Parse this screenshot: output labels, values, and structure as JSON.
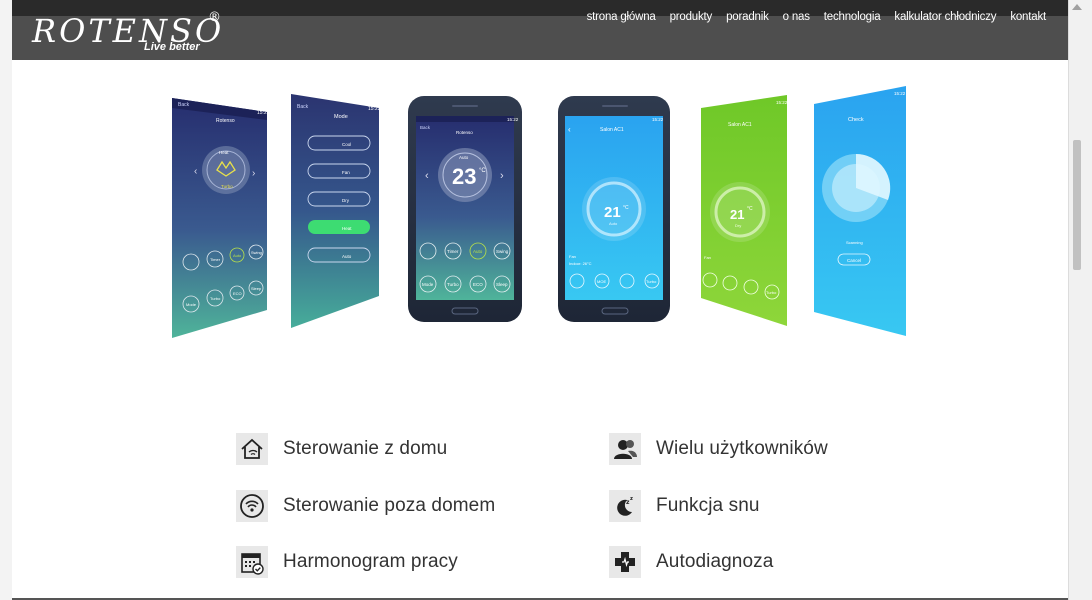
{
  "brand": {
    "name": "ROTENSO",
    "registered": "®",
    "tagline": "Live better"
  },
  "nav": {
    "items": [
      {
        "label": "strona główna"
      },
      {
        "label": "produkty"
      },
      {
        "label": "poradnik"
      },
      {
        "label": "o nas"
      },
      {
        "label": "technologia"
      },
      {
        "label": "kalkulator chłodniczy"
      },
      {
        "label": "kontakt"
      }
    ]
  },
  "phones": {
    "screen1": {
      "back": "Back",
      "title": "Rotenso",
      "mode": "Heat",
      "sub": "Turbo",
      "time": "15:22",
      "buttons": [
        "Timer",
        "Auto",
        "Swing",
        "Mode",
        "Turbo",
        "ECO",
        "Sleep"
      ]
    },
    "screen2": {
      "back": "Back",
      "title": "Mode",
      "time": "15:22",
      "options": [
        "Cool",
        "Fan",
        "Dry",
        "Heat",
        "Auto"
      ]
    },
    "screen3": {
      "back": "Back",
      "title": "Rotenso",
      "time": "15:22",
      "mode": "Auto",
      "temp": "23",
      "unit": "°C",
      "buttons": [
        "Timer",
        "Auto",
        "Swing",
        "Mode",
        "Turbo",
        "ECO",
        "Sleep"
      ]
    },
    "screen4": {
      "title": "Salon AC1",
      "time": "15:22",
      "temp": "21",
      "unit": "°C",
      "state": "Auto",
      "fan": "Fan",
      "indoor": "Indoor: 26°C",
      "buttons": [
        "MOE",
        "Turbo"
      ]
    },
    "screen5": {
      "title": "Salon AC1",
      "time": "15:22",
      "temp": "21",
      "unit": "°C",
      "state": "Dry",
      "fan": "Fan",
      "buttons": [
        "Turbo"
      ]
    },
    "screen6": {
      "title": "Check",
      "time": "15:22",
      "status": "Scanning",
      "cancel": "Cancel"
    }
  },
  "features": {
    "items": [
      {
        "label": "Sterowanie z domu",
        "icon": "home-wifi-icon"
      },
      {
        "label": "Wielu użytkowników",
        "icon": "users-icon"
      },
      {
        "label": "Sterowanie poza domem",
        "icon": "wifi-icon"
      },
      {
        "label": "Funkcja snu",
        "icon": "moon-sleep-icon"
      },
      {
        "label": "Harmonogram pracy",
        "icon": "calendar-icon"
      },
      {
        "label": "Autodiagnoza",
        "icon": "diagnosis-icon"
      }
    ]
  },
  "colors": {
    "header_bg": "#4e4e4e",
    "screen_blue": "#29a9ee",
    "screen_green": "#7fcf2e",
    "screen_navy": "#2d3a78"
  }
}
